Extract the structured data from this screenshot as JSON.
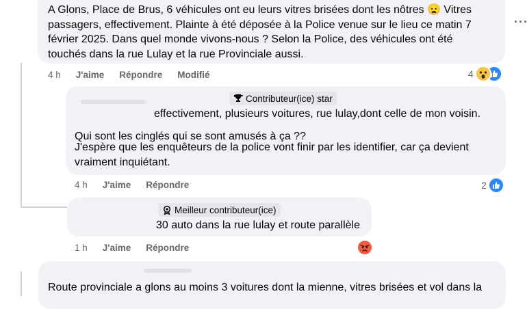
{
  "comment1": {
    "text": "A Glons, Place de Brus, 6 véhicules ont eu leurs vitres brisées dont les nôtres 😦 Vitres passagers, effectivement. Plainte à été déposée à la Police venue sur le lieu ce matin 7 février 2025. Dans quel monde vivons-nous ? Selon la Police, des véhicules ont été touchés dans la rue Lulay et la rue Provinciale aussi.",
    "time": "4 h",
    "like": "J'aime",
    "reply": "Répondre",
    "edited": "Modifié",
    "reaction_count": "4"
  },
  "reply1": {
    "badge": "Contributeur(ice) star",
    "line1": "effectivement, plusieurs voitures, rue lulay,dont celle de mon voisin.",
    "line2": "Qui sont les cinglés qui se sont amusés à ça ??",
    "line3": "J'espère que les enquêteurs de la police vont finir par les identifier, car ça devient vraiment inquiétant.",
    "time": "4 h",
    "like": "J'aime",
    "reply": "Répondre",
    "reaction_count": "2"
  },
  "reply2": {
    "badge": "Meilleur contributeur(ice)",
    "text": "30 auto dans la rue lulay et route parallèle",
    "time": "1 h",
    "like": "J'aime",
    "reply": "Répondre"
  },
  "comment2": {
    "text": "Route provinciale a glons au moins 3 voitures dont la mienne, vitres brisées et vol dans la"
  },
  "icons": {
    "more": "more-horizontal-icon",
    "like": "like-reaction-icon",
    "wow": "wow-reaction-icon",
    "angry": "angry-reaction-icon",
    "trophy": "trophy-icon",
    "medal": "medal-icon"
  },
  "colors": {
    "bubble": "#f0f2f5",
    "meta": "#65676b",
    "like_blue": "#2d88ff",
    "angry_red": "#f15c43"
  }
}
